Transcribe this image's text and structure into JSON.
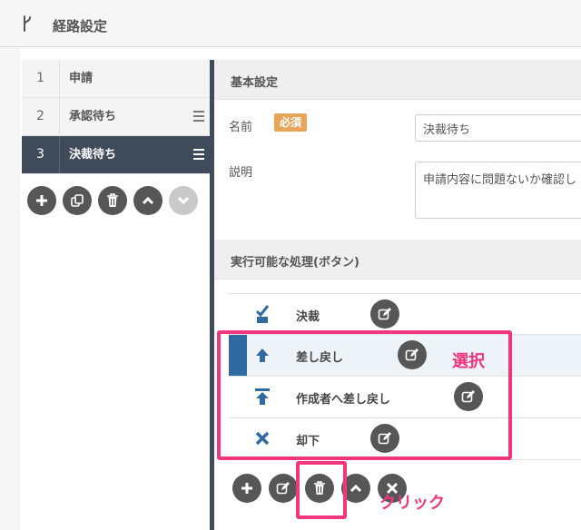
{
  "header": {
    "title": "経路設定",
    "icon": "route-icon"
  },
  "steps": [
    {
      "num": "1",
      "label": "申請",
      "active": false,
      "draggable": false
    },
    {
      "num": "2",
      "label": "承認待ち",
      "active": false,
      "draggable": true
    },
    {
      "num": "3",
      "label": "決裁待ち",
      "active": true,
      "draggable": true
    }
  ],
  "step_tools": [
    "add-icon",
    "copy-icon",
    "trash-icon",
    "chevron-up-icon",
    "chevron-down-icon"
  ],
  "basic": {
    "heading": "基本設定",
    "name_label": "名前",
    "required_badge": "必須",
    "name_value": "決裁待ち",
    "description_label": "説明",
    "description_value": "申請内容に問題ないか確認し"
  },
  "actions": {
    "heading": "実行可能な処理(ボタン)",
    "items": [
      {
        "label": "決裁",
        "icon": "check-icon",
        "selected": false
      },
      {
        "label": "差し戻し",
        "icon": "arrow-up-icon",
        "selected": true
      },
      {
        "label": "作成者へ差し戻し",
        "icon": "arrow-up-to-top-icon",
        "selected": false
      },
      {
        "label": "却下",
        "icon": "x-icon",
        "selected": false
      }
    ]
  },
  "annotations": {
    "select": "選択",
    "click": "クリック"
  },
  "colors": {
    "accent": "#2f6aa3",
    "dark_step": "#3f4a5a",
    "badge": "#e8a55a",
    "annotation": "#f0367d",
    "button": "#565656"
  }
}
